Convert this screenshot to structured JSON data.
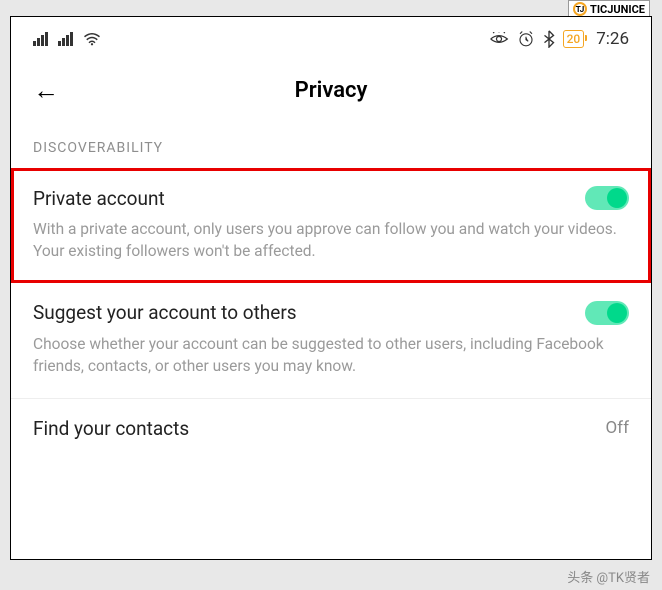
{
  "watermark": {
    "top_text": "TICJUNICE",
    "bottom_text": "头条 @TK贤者"
  },
  "status_bar": {
    "battery": "20",
    "time": "7:26"
  },
  "header": {
    "title": "Privacy"
  },
  "section": {
    "label": "DISCOVERABILITY"
  },
  "items": {
    "private_account": {
      "title": "Private account",
      "desc": "With a private account, only users you approve can follow you and watch your videos. Your existing followers won't be affected."
    },
    "suggest": {
      "title": "Suggest your account to others",
      "desc": "Choose whether your account can be suggested to other users, including Facebook friends, contacts, or other users you may know."
    },
    "find_contacts": {
      "title": "Find your contacts",
      "value": "Off"
    }
  }
}
